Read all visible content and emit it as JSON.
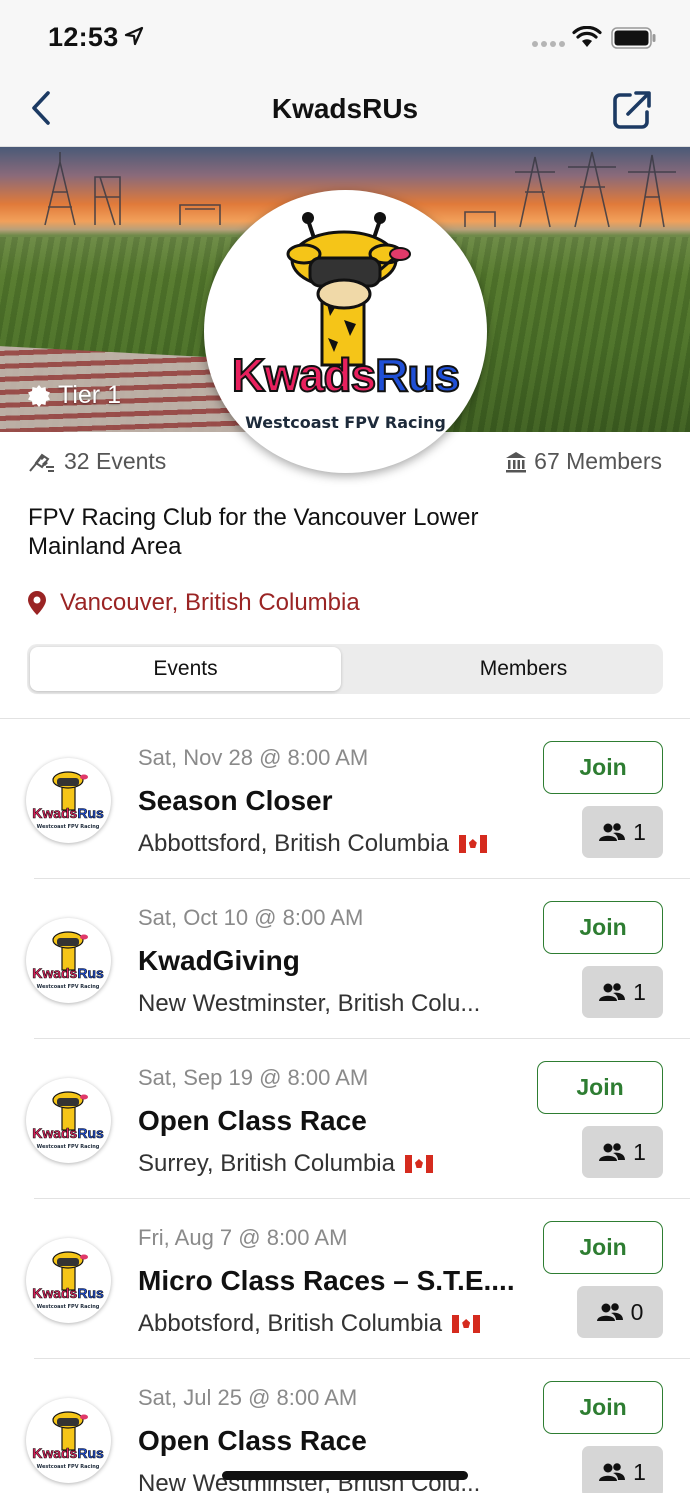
{
  "status_bar": {
    "time": "12:53"
  },
  "nav": {
    "title": "KwadsRUs"
  },
  "banner": {
    "tier_label": "Tier 1"
  },
  "logo": {
    "main_text": "KwadsRus",
    "sub_text": "Westcoast FPV Racing"
  },
  "stats": {
    "events": "32 Events",
    "members": "67 Members"
  },
  "club": {
    "description": "FPV Racing Club for the Vancouver Lower Mainland Area",
    "location": "Vancouver, British Columbia"
  },
  "tabs": {
    "events": "Events",
    "members": "Members",
    "selected": "Events"
  },
  "events": [
    {
      "date": "Sat, Nov 28 @ 8:00 AM",
      "title": "Season Closer",
      "place": "Abbottsford, British Columbia",
      "flag": true,
      "join": "Join",
      "count": "1"
    },
    {
      "date": "Sat, Oct 10 @ 8:00 AM",
      "title": "KwadGiving",
      "place": "New Westminster, British Colu...",
      "flag": false,
      "join": "Join",
      "count": "1"
    },
    {
      "date": "Sat, Sep 19 @ 8:00 AM",
      "title": "Open Class Race",
      "place": "Surrey, British Columbia",
      "flag": true,
      "join": "Join",
      "count": "1"
    },
    {
      "date": "Fri, Aug 7 @ 8:00 AM",
      "title": "Micro Class Races – S.T.E....",
      "place": "Abbotsford, British Columbia",
      "flag": true,
      "join": "Join",
      "count": "0"
    },
    {
      "date": "Sat, Jul 25 @ 8:00 AM",
      "title": "Open Class Race",
      "place": "New Westminster, British Colu...",
      "flag": false,
      "join": "Join",
      "count": "1"
    }
  ],
  "colors": {
    "accent_green": "#2e7d32",
    "location_red": "#9a2424",
    "badge_gray": "#d6d6d6"
  }
}
